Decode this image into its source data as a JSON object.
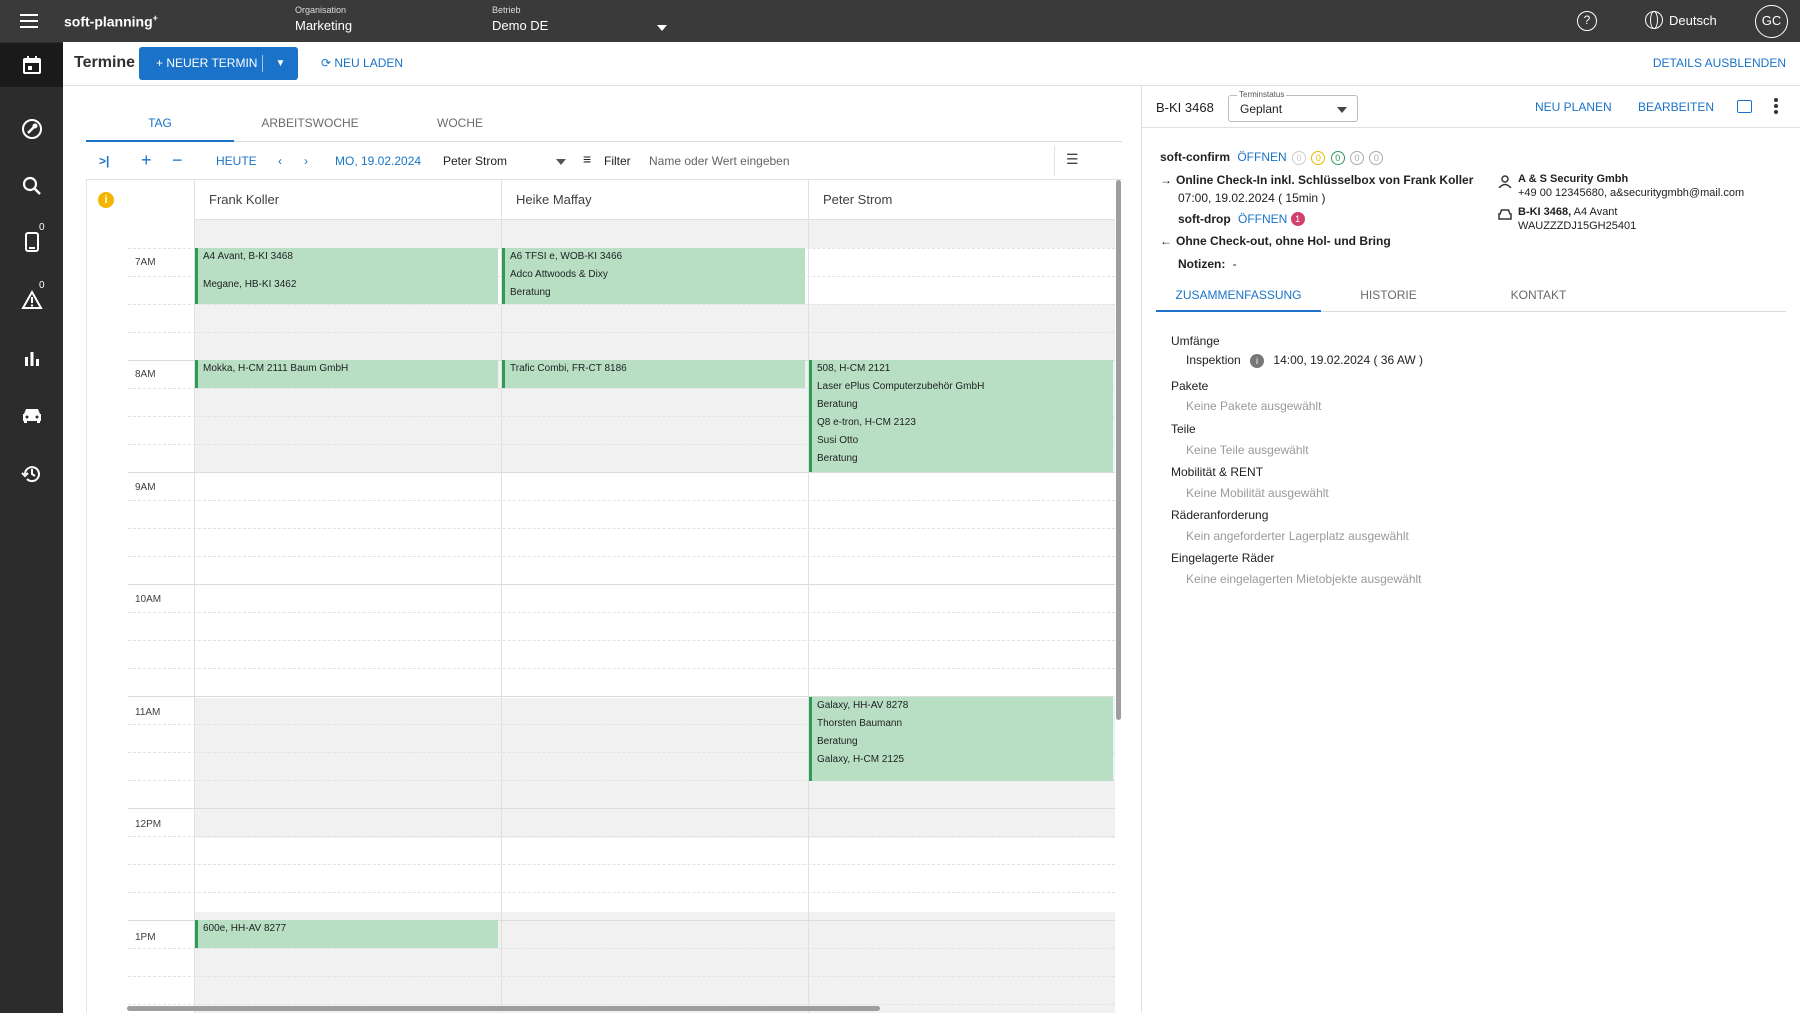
{
  "topbar": {
    "brand": "soft-planning",
    "brand_sup": "+",
    "org_label": "Organisation",
    "org_value": "Marketing",
    "betrieb_label": "Betrieb",
    "betrieb_value": "Demo DE",
    "help": "?",
    "language": "Deutsch",
    "avatar": "GC"
  },
  "sidebar": {
    "items": [
      {
        "name": "calendar",
        "badge": ""
      },
      {
        "name": "tools",
        "badge": ""
      },
      {
        "name": "search",
        "badge": ""
      },
      {
        "name": "mobile",
        "badge": "0"
      },
      {
        "name": "warning",
        "badge": "0"
      },
      {
        "name": "stats",
        "badge": ""
      },
      {
        "name": "car",
        "badge": ""
      },
      {
        "name": "history",
        "badge": ""
      }
    ]
  },
  "header": {
    "title": "Termine",
    "new_button": "+ NEUER TERMIN",
    "reload": "⟳ NEU LADEN",
    "hide_details": "DETAILS AUSBLENDEN"
  },
  "calendar": {
    "tabs": [
      "TAG",
      "ARBEITSWOCHE",
      "WOCHE"
    ],
    "toolbar": {
      "today": "HEUTE",
      "date": "MO, 19.02.2024",
      "person": "Peter Strom",
      "filter": "Filter",
      "filter_placeholder": "Name oder Wert eingeben"
    },
    "columns": [
      "Frank Koller",
      "Heike Maffay",
      "Peter Strom"
    ],
    "times": [
      "7AM",
      "8AM",
      "9AM",
      "10AM",
      "11AM",
      "12PM",
      "1PM"
    ],
    "events": {
      "e1": [
        "A4 Avant, B-KI 3468",
        "Megane, HB-KI 3462"
      ],
      "e2": [
        "A6 TFSI e, WOB-KI 3466",
        "Adco Attwoods & Dixy",
        "Beratung"
      ],
      "e3": [
        "Mokka, H-CM 2111 Baum GmbH"
      ],
      "e4": [
        "Trafic Combi, FR-CT 8186"
      ],
      "e5": [
        "508, H-CM 2121",
        "Laser ePlus Computerzubehör GmbH",
        "Beratung",
        "Q8 e-tron, H-CM 2123",
        "Susi Otto",
        "Beratung"
      ],
      "e6": [
        "Galaxy, HH-AV 8278",
        "Thorsten Baumann",
        "Beratung",
        "Galaxy, H-CM 2125"
      ],
      "e7": [
        "600e, HH-AV 8277"
      ]
    }
  },
  "detail": {
    "plate": "B-KI 3468",
    "status_label": "Terminstatus",
    "status_value": "Geplant",
    "neu_planen": "NEU PLANEN",
    "bearbeiten": "BEARBEITEN",
    "soft_confirm": "soft-confirm",
    "oeffnen": "ÖFFNEN",
    "confirm_counts": [
      "0",
      "0",
      "0",
      "0",
      "0"
    ],
    "checkin": "Online Check-In inkl. Schlüsselbox von Frank Koller",
    "checkin_time": "07:00, 19.02.2024 ( 15min )",
    "soft_drop": "soft-drop",
    "soft_drop_badge": "1",
    "checkout": "Ohne Check-out, ohne Hol- und Bring",
    "notes_label": "Notizen:",
    "notes_value": "-",
    "customer_name": "A & S Security Gmbh",
    "customer_contact": "+49 00 12345680, a&securitygmbh@mail.com",
    "vehicle": "B-KI 3468,",
    "vehicle_model": " A4 Avant",
    "vin": "WAUZZZDJ15GH25401",
    "tabs": [
      "ZUSAMMENFASSUNG",
      "HISTORIE",
      "KONTAKT"
    ],
    "summary": {
      "umfaenge": "Umfänge",
      "inspektion": "Inspektion",
      "inspektion_time": "14:00, 19.02.2024 ( 36 AW )",
      "pakete": "Pakete",
      "pakete_v": "Keine Pakete ausgewählt",
      "teile": "Teile",
      "teile_v": "Keine Teile ausgewählt",
      "mobil": "Mobilität & RENT",
      "mobil_v": "Keine Mobilität ausgewählt",
      "raeder": "Räderanforderung",
      "raeder_v": "Kein angeforderter Lagerplatz ausgewählt",
      "eingelagert": "Eingelagerte Räder",
      "eingelagert_v": "Keine eingelagerten Mietobjekte ausgewählt"
    }
  }
}
